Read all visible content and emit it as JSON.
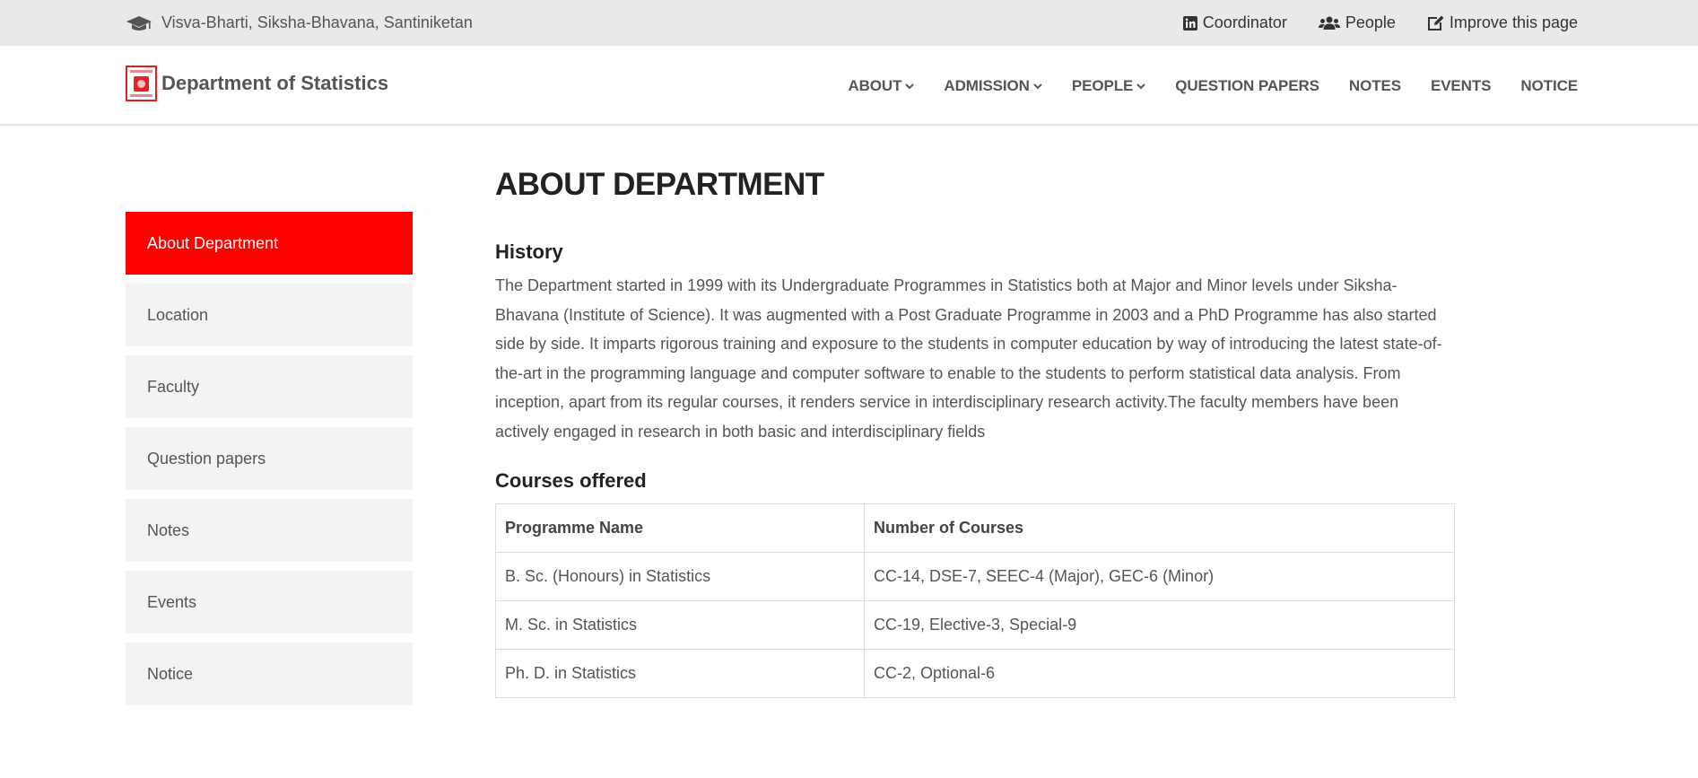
{
  "topbar": {
    "institution": "Visva-Bharti, Siksha-Bhavana, Santiniketan",
    "links": [
      {
        "icon": "linkedin-icon",
        "label": "Coordinator"
      },
      {
        "icon": "users-icon",
        "label": "People"
      },
      {
        "icon": "edit-icon",
        "label": "Improve this page"
      }
    ]
  },
  "navbar": {
    "brand": "Department of Statistics",
    "items": [
      {
        "label": "ABOUT",
        "dropdown": true
      },
      {
        "label": "ADMISSION",
        "dropdown": true
      },
      {
        "label": "PEOPLE",
        "dropdown": true
      },
      {
        "label": "QUESTION PAPERS",
        "dropdown": false
      },
      {
        "label": "NOTES",
        "dropdown": false
      },
      {
        "label": "EVENTS",
        "dropdown": false
      },
      {
        "label": "NOTICE",
        "dropdown": false
      }
    ]
  },
  "sidebar": {
    "active_color": "#ff0000",
    "items": [
      {
        "label": "About Department",
        "active": true
      },
      {
        "label": "Location",
        "active": false
      },
      {
        "label": "Faculty",
        "active": false
      },
      {
        "label": "Question papers",
        "active": false
      },
      {
        "label": "Notes",
        "active": false
      },
      {
        "label": "Events",
        "active": false
      },
      {
        "label": "Notice",
        "active": false
      }
    ]
  },
  "main": {
    "title": "ABOUT DEPARTMENT",
    "history": {
      "heading": "History",
      "text": "The Department started in 1999 with its Undergraduate Programmes in Statistics both at Major and Minor levels under Siksha-Bhavana (Institute of Science). It was augmented with a Post Graduate Programme in 2003 and a PhD Programme has also started side by side. It imparts rigorous training and exposure to the students in computer education by way of introducing the latest state-of-the-art in the programming language and computer software to enable to the students to perform statistical data analysis. From inception, apart from its regular courses, it renders service in interdisciplinary research activity.The faculty members have been actively engaged in research in both basic and interdisciplinary fields"
    },
    "courses": {
      "heading": "Courses offered",
      "columns": [
        "Programme Name",
        "Number of Courses"
      ],
      "rows": [
        [
          "B. Sc. (Honours) in Statistics",
          "CC-14, DSE-7, SEEC-4 (Major), GEC-6 (Minor)"
        ],
        [
          "M. Sc. in Statistics",
          "CC-19, Elective-3, Special-9"
        ],
        [
          "Ph. D. in Statistics",
          "CC-2, Optional-6"
        ]
      ]
    }
  }
}
